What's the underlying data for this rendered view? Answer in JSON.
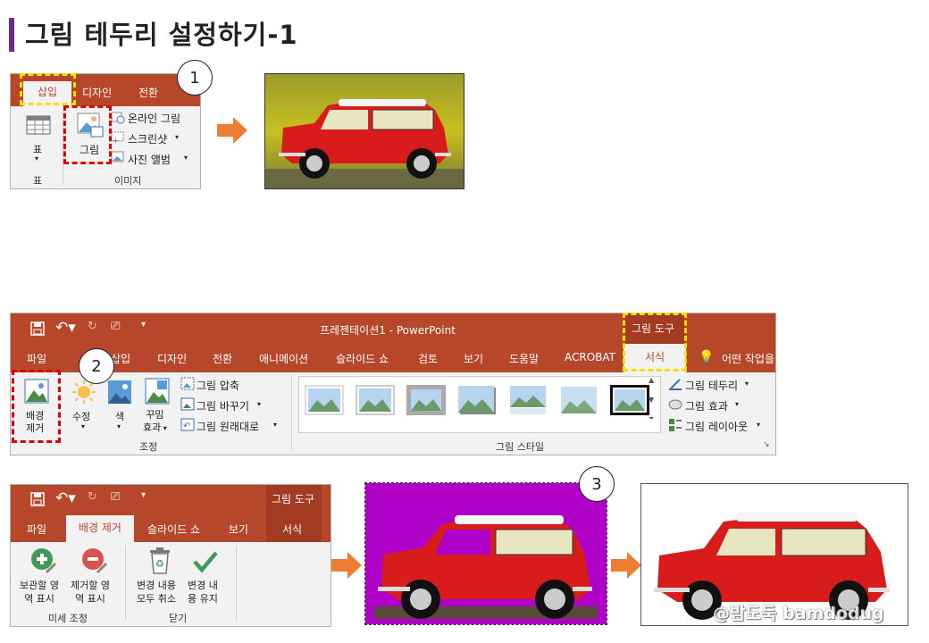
{
  "page": {
    "title": "그림 테두리 설정하기-1"
  },
  "step1": {
    "tabs": [
      "삽입",
      "디자인",
      "전환"
    ],
    "table_label": "표",
    "table_group": "표",
    "picture_label": "그림",
    "online_picture": "온라인 그림",
    "screenshot": "스크린샷",
    "photo_album": "사진 앨범",
    "images_group": "이미지",
    "badge": "1"
  },
  "step2": {
    "doc_title": "프레젠테이션1  -  PowerPoint",
    "context_tab": "그림 도구",
    "tabs": [
      "파일",
      "삽입",
      "디자인",
      "전환",
      "애니메이션",
      "슬라이드 쇼",
      "검토",
      "보기",
      "도움말",
      "ACROBAT"
    ],
    "active_tab": "서식",
    "tell_me": "어떤 작업을",
    "remove_bg": [
      "배경",
      "제거"
    ],
    "corrections": "수정",
    "color": "색",
    "artistic": [
      "꾸밈",
      "효과"
    ],
    "compress": "그림 압축",
    "change": "그림 바꾸기",
    "reset": "그림 원래대로",
    "adjust_group": "조정",
    "border": "그림 테두리",
    "effects": "그림 효과",
    "layout": "그림 레이아웃",
    "styles_group": "그림 스타일",
    "badge": "2"
  },
  "step3": {
    "context_tab": "그림 도구",
    "tabs": [
      "파일",
      "배경 제거",
      "슬라이드 쇼",
      "보기",
      "서식"
    ],
    "mark_keep": [
      "보관할 영",
      "역 표시"
    ],
    "mark_remove": [
      "제거할 영",
      "역 표시"
    ],
    "discard": [
      "변경 내용",
      "모두 취소"
    ],
    "keep": [
      "변경 내",
      "용 유지"
    ],
    "refine_group": "미세 조정",
    "close_group": "닫기",
    "badge": "3"
  },
  "watermark": "@밤도둑 bamdodug",
  "colors": {
    "ribbon_red": "#b7472a",
    "highlight_yellow": "#f2e200",
    "highlight_red": "#e00000",
    "arrow_orange": "#ed7d31",
    "magenta": "#b000c8"
  }
}
